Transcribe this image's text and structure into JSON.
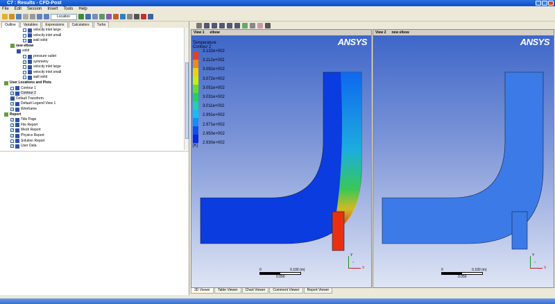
{
  "window": {
    "title": "C7 : Results - CFD-Post"
  },
  "menu": [
    "File",
    "Edit",
    "Session",
    "Insert",
    "Tools",
    "Help"
  ],
  "toolbar": {
    "location_label": "Location"
  },
  "left_tabs": [
    "Outline",
    "Variables",
    "Expressions",
    "Calculators",
    "Turbo"
  ],
  "tree": [
    {
      "label": "velocity inlet large",
      "level": 3,
      "checked": false
    },
    {
      "label": "velocity inlet small",
      "level": 3,
      "checked": false
    },
    {
      "label": "wall solid",
      "level": 3,
      "checked": false
    },
    {
      "label": "new elbow",
      "level": 1,
      "bold": true
    },
    {
      "label": "solid",
      "level": 2
    },
    {
      "label": "pressure outlet",
      "level": 3,
      "checked": false
    },
    {
      "label": "symmetry",
      "level": 3,
      "checked": true
    },
    {
      "label": "velocity inlet large",
      "level": 3,
      "checked": false
    },
    {
      "label": "velocity inlet small",
      "level": 3,
      "checked": false
    },
    {
      "label": "wall solid",
      "level": 3,
      "checked": false
    },
    {
      "label": "User Locations and Plots",
      "level": 0,
      "bold": true
    },
    {
      "label": "Contour 1",
      "level": 1,
      "checked": false
    },
    {
      "label": "Contour 2",
      "level": 1,
      "checked": true
    },
    {
      "label": "Default Transform",
      "level": 1
    },
    {
      "label": "Default Legend View 1",
      "level": 1,
      "checked": true
    },
    {
      "label": "Wireframe",
      "level": 1,
      "checked": true
    },
    {
      "label": "Report",
      "level": 0,
      "bold": true
    },
    {
      "label": "Title Page",
      "level": 1,
      "checked": true
    },
    {
      "label": "File Report",
      "level": 1,
      "checked": true
    },
    {
      "label": "Mesh Report",
      "level": 1,
      "checked": true
    },
    {
      "label": "Physics Report",
      "level": 1,
      "checked": true
    },
    {
      "label": "Solution Report",
      "level": 1,
      "checked": false
    },
    {
      "label": "User Data",
      "level": 1,
      "checked": true
    }
  ],
  "view1": {
    "name": "View 1",
    "object": "elbow",
    "logo": "ANSYS"
  },
  "view2": {
    "name": "View 2",
    "object": "new elbow",
    "logo": "ANSYS"
  },
  "legend": {
    "variable": "Temperature",
    "plot": "Contour 2",
    "unit": "[K]",
    "values": [
      "3.132e+002",
      "3.112e+002",
      "3.092e+002",
      "3.072e+002",
      "3.051e+002",
      "3.031e+002",
      "3.011e+002",
      "2.991e+002",
      "2.971e+002",
      "2.950e+002",
      "2.930e+002"
    ],
    "colors": [
      "#e8401a",
      "#f08a10",
      "#f5d000",
      "#c8f000",
      "#60e020",
      "#20d060",
      "#20d0b0",
      "#10c0f0",
      "#1090f0",
      "#1050e8",
      "#0a28d8"
    ]
  },
  "scale": {
    "start": "0",
    "end": "0.100",
    "unit": "(m)",
    "mid": "0.050"
  },
  "axes": {
    "y": "Y",
    "x": "X",
    "z": "Z"
  },
  "bottom_tabs": [
    "3D Viewer",
    "Table Viewer",
    "Chart Viewer",
    "Comment Viewer",
    "Report Viewer"
  ]
}
